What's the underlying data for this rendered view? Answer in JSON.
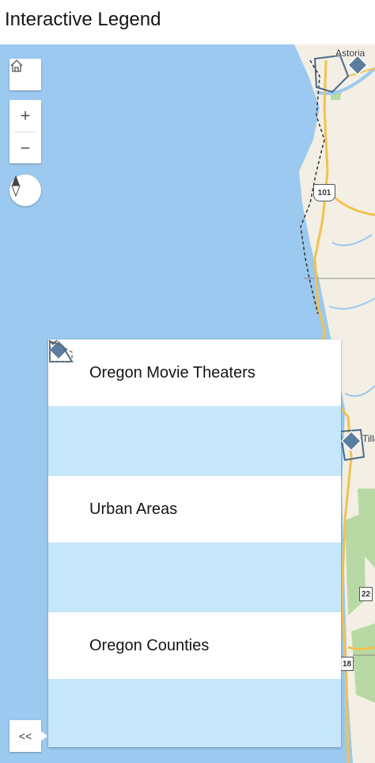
{
  "app": {
    "title": "Interactive Legend"
  },
  "map": {
    "labels": {
      "astoria": "Astoria",
      "tillamook_partial": "Tilla"
    },
    "shields": {
      "us101": "101",
      "hwy22": "22",
      "hwy18": "18"
    },
    "colors": {
      "water": "#9cc9ef",
      "land": "#f3efe4",
      "park": "#b9d9a4",
      "road_major": "#f2c24f",
      "theater": "#5b7d9e"
    }
  },
  "controls": {
    "home_icon": "home-icon",
    "zoom_in_label": "+",
    "zoom_out_label": "−",
    "compass_icon": "compass-icon",
    "collapse_label": "<<"
  },
  "legend": {
    "layers": [
      {
        "title": "Oregon Movie Theaters",
        "symbol": "diamond-icon"
      },
      {
        "title": "Urban Areas",
        "symbol": "polygon-outline-icon"
      },
      {
        "title": "Oregon Counties",
        "symbol": "dashed-polygon-icon"
      }
    ]
  }
}
